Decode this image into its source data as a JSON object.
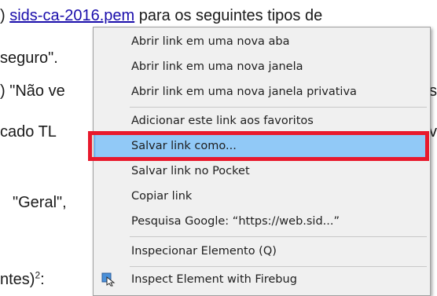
{
  "document": {
    "line1_prefix": ") ",
    "line1_link": "sids-ca-2016.pem",
    "line1_suffix": " para os seguintes tipos de",
    "line2": "seguro\".",
    "line3_left": ") \"Não ve",
    "line3_right": "s",
    "line4": "cado TL",
    "line4_right": "v",
    "line5": "\"Geral\",",
    "line6_main": "ntes)",
    "line6_sup": "2",
    "line6_after": ":"
  },
  "context_menu": {
    "items": [
      {
        "label": "Abrir link em uma nova aba"
      },
      {
        "label": "Abrir link em uma nova janela"
      },
      {
        "label": "Abrir link em uma nova janela privativa"
      },
      {
        "label": "Adicionar este link aos favoritos"
      },
      {
        "label": "Salvar link como..."
      },
      {
        "label": "Salvar link no Pocket"
      },
      {
        "label": "Copiar link"
      },
      {
        "label": "Pesquisa Google: “https://web.sid...”"
      },
      {
        "label": "Inspecionar Elemento (Q)"
      },
      {
        "label": "Inspect Element with Firebug"
      }
    ],
    "highlighted_item": "Salvar link como..."
  },
  "colors": {
    "link": "#1a0dab",
    "highlight": "#91c9f7",
    "annotation_box": "#e8192c"
  },
  "icons": {
    "firebug": "firebug-inspect-icon"
  }
}
